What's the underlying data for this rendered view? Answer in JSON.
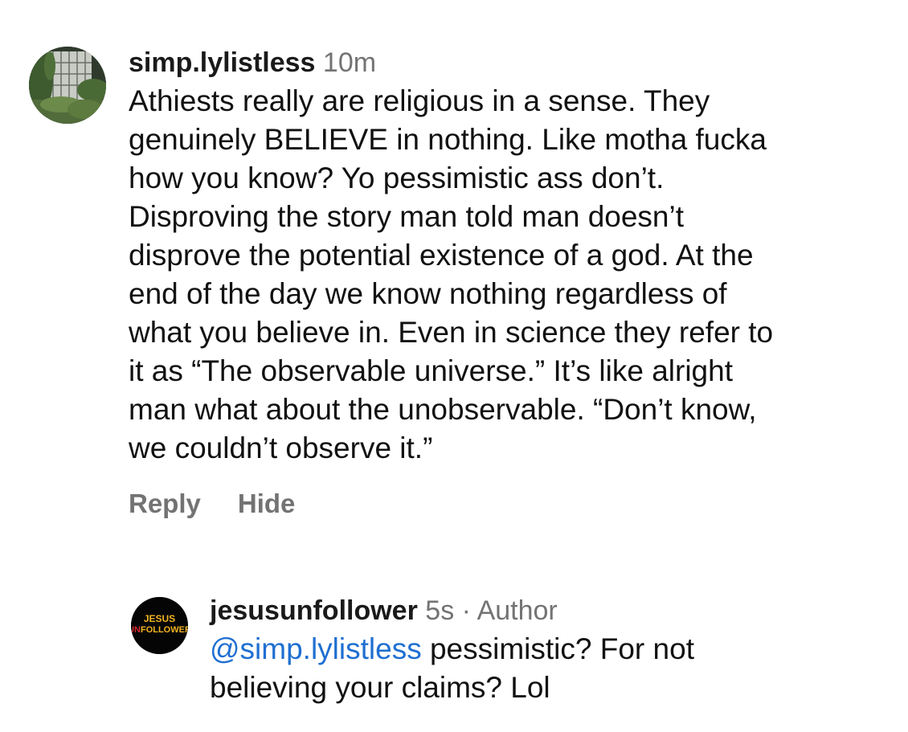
{
  "comments": [
    {
      "username": "simp.lylistless",
      "time": "10m",
      "lines": [
        "Athiests really are religious in a sense. They",
        "genuinely BELIEVE in nothing. Like motha fucka",
        "how you know? Yo pessimistic ass don’t.",
        "Disproving the story man told man doesn’t",
        "disprove the potential existence of a god. At the",
        "end of the day we know nothing regardless of",
        "what you believe in. Even in science they refer to",
        "it as “The observable universe.” It’s like alright",
        "man what about the unobservable. “Don’t know,",
        "we couldn’t observe it.”"
      ],
      "actions": {
        "reply": "Reply",
        "hide": "Hide"
      }
    },
    {
      "username": "jesusunfollower",
      "time": "5s",
      "separator": "·",
      "author_badge": "Author",
      "mention": "@simp.lylistless",
      "line1_rest": " pessimistic? For not",
      "line2": "believing your claims? Lol",
      "avatar_logo": {
        "line1": "JESUS",
        "line2_prefix": "UN",
        "line2_rest": "FOLLOWER"
      }
    }
  ],
  "colors": {
    "mention": "#1f6fd1",
    "muted": "#737373",
    "text": "#111111",
    "logo_red": "#d3282c",
    "logo_yellow": "#f2b322"
  },
  "icons": {
    "avatar_1": "greenhouse-window-photo",
    "avatar_2": "jesus-unfollower-logo"
  }
}
